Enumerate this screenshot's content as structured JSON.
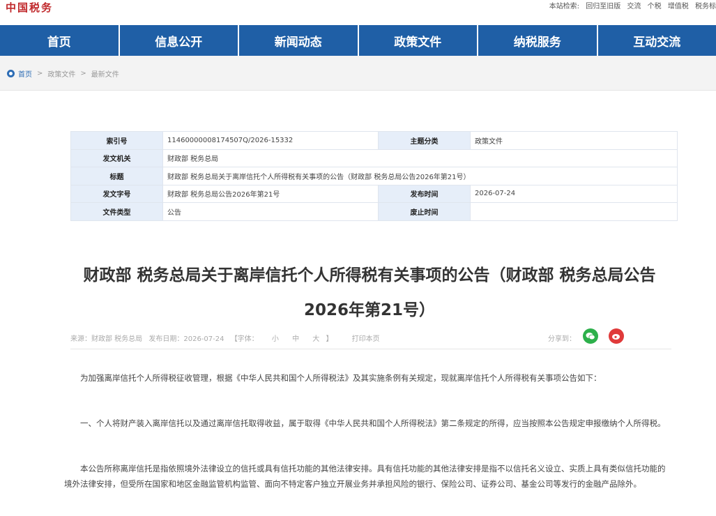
{
  "header": {
    "logo_text": "中国税务",
    "top_links": [
      "本站检索:",
      "回归至旧版",
      "交流",
      "个税",
      "增值税",
      "税务标"
    ]
  },
  "nav": {
    "items": [
      "首页",
      "信息公开",
      "新闻动态",
      "政策文件",
      "纳税服务",
      "互动交流"
    ]
  },
  "breadcrumb": {
    "home": "首页",
    "level1": "政策文件",
    "level2": "最新文件",
    "separator": ">"
  },
  "meta": {
    "index_label": "索引号",
    "index_value": "11460000008174507Q/2026-15332",
    "topic_label": "主题分类",
    "topic_value": "政策文件",
    "issuer_label": "发文机关",
    "issuer_value": "财政部 税务总局",
    "title_label": "标题",
    "title_value": "财政部 税务总局关于离岸信托个人所得税有关事项的公告（财政部 税务总局公告2026年第21号）",
    "docno_label": "发文字号",
    "docno_value": "财政部 税务总局公告2026年第21号",
    "pubdate_label": "发布时间",
    "pubdate_value": "2026-07-24",
    "doctype_label": "文件类型",
    "doctype_value": "公告",
    "expire_label": "废止时间",
    "expire_value": ""
  },
  "article": {
    "title": "财政部 税务总局关于离岸信托个人所得税有关事项的公告（财政部 税务总局公告2026年第21号）",
    "source": "来源：财政部 税务总局",
    "date": "发布日期：2026-07-24",
    "font_label": "【字体：",
    "font_small": "小",
    "font_medium": "中",
    "font_large": "大",
    "font_close": "】",
    "print": "打印本页",
    "share_label": "分享到：",
    "paragraphs": [
      "为加强离岸信托个人所得税征收管理，根据《中华人民共和国个人所得税法》及其实施条例有关规定，现就离岸信托个人所得税有关事项公告如下：",
      "一、个人将财产装入离岸信托以及通过离岸信托取得收益，属于取得《中华人民共和国个人所得税法》第二条规定的所得，应当按照本公告规定申报缴纳个人所得税。",
      "本公告所称离岸信托是指依照境外法律设立的信托或具有信托功能的其他法律安排。具有信托功能的其他法律安排是指不以信托名义设立、实质上具有类似信托功能的境外法律安排，但受所在国家和地区金融监管机构监管、面向不特定客户独立开展业务并承担风险的银行、保险公司、证券公司、基金公司等发行的金融产品除外。"
    ]
  },
  "colors": {
    "nav_bg": "#1f5fa6",
    "meta_key_bg": "#e6eef9",
    "logo_red": "#c0282b",
    "wechat_green": "#2db04b",
    "weibo_red": "#e03a3a"
  }
}
